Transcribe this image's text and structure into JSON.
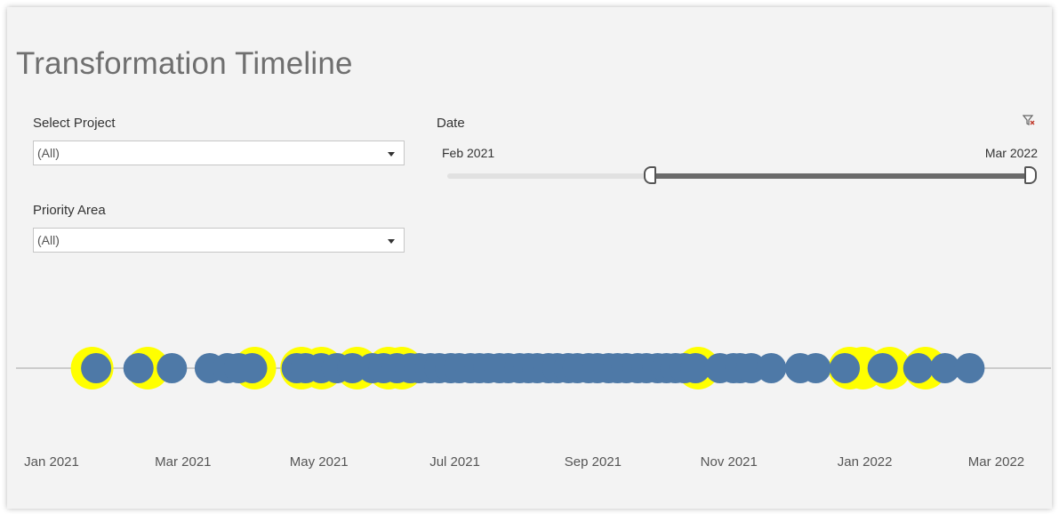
{
  "dashboard": {
    "title": "Transformation Timeline",
    "filters": {
      "project": {
        "label": "Select Project",
        "value": "(All)"
      },
      "priority": {
        "label": "Priority Area",
        "value": "(All)"
      }
    },
    "date_filter": {
      "label": "Date",
      "start_label": "Feb 2021",
      "end_label": "Mar 2022",
      "selected_start_fraction": 0.35,
      "selected_end_fraction": 1.0,
      "clear_icon": "clear-filter-icon"
    }
  },
  "colors": {
    "dot": "#4e79a7",
    "highlight": "#ffff00",
    "axis_line": "#cccccc",
    "title": "#6f6f6f"
  },
  "chart_data": {
    "type": "scatter",
    "x_axis_type": "date",
    "xlim": [
      "2021-01-01",
      "2022-03-08"
    ],
    "x_ticks": [
      {
        "date": "2021-01-01",
        "label": "Jan 2021"
      },
      {
        "date": "2021-03-01",
        "label": "Mar 2021"
      },
      {
        "date": "2021-05-01",
        "label": "May 2021"
      },
      {
        "date": "2021-07-01",
        "label": "Jul 2021"
      },
      {
        "date": "2021-09-01",
        "label": "Sep 2021"
      },
      {
        "date": "2021-11-01",
        "label": "Nov 2021"
      },
      {
        "date": "2022-01-01",
        "label": "Jan 2022"
      },
      {
        "date": "2022-03-01",
        "label": "Mar 2022"
      }
    ],
    "highlighted_dates": [
      "2021-01-18",
      "2021-02-12",
      "2021-04-01",
      "2021-04-22",
      "2021-05-01",
      "2021-05-17",
      "2021-05-31",
      "2021-06-06",
      "2021-10-17",
      "2021-12-24",
      "2021-12-30",
      "2022-01-11",
      "2022-01-27"
    ],
    "event_dates": [
      "2021-01-21",
      "2021-02-09",
      "2021-02-24",
      "2021-03-13",
      "2021-03-21",
      "2021-03-26",
      "2021-04-01",
      "2021-04-21",
      "2021-04-25",
      "2021-05-02",
      "2021-05-09",
      "2021-05-16",
      "2021-05-25",
      "2021-05-30",
      "2021-06-05",
      "2021-06-11",
      "2021-06-15",
      "2021-06-20",
      "2021-06-24",
      "2021-06-29",
      "2021-07-03",
      "2021-07-08",
      "2021-07-12",
      "2021-07-16",
      "2021-07-21",
      "2021-07-25",
      "2021-07-30",
      "2021-08-03",
      "2021-08-07",
      "2021-08-12",
      "2021-08-16",
      "2021-08-21",
      "2021-08-25",
      "2021-08-30",
      "2021-09-03",
      "2021-09-08",
      "2021-09-12",
      "2021-09-16",
      "2021-09-21",
      "2021-09-25",
      "2021-09-30",
      "2021-10-04",
      "2021-10-08",
      "2021-10-12",
      "2021-10-17",
      "2021-10-28",
      "2021-11-03",
      "2021-11-06",
      "2021-11-11",
      "2021-11-20",
      "2021-12-03",
      "2021-12-10",
      "2021-12-23",
      "2022-01-09",
      "2022-01-25",
      "2022-02-06",
      "2022-02-17"
    ]
  }
}
